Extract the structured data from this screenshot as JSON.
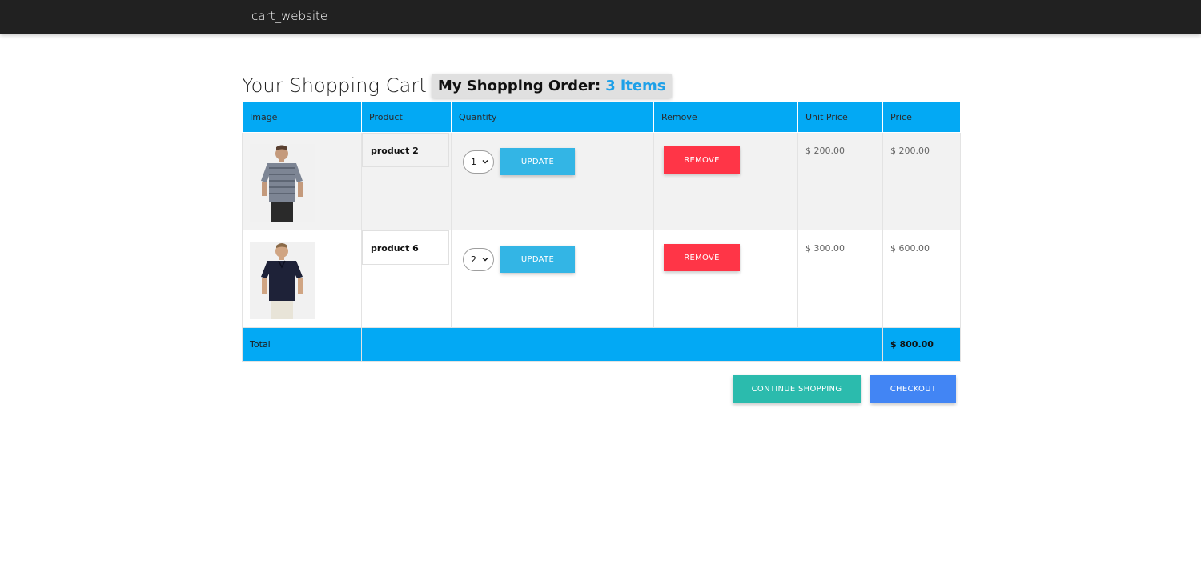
{
  "navbar": {
    "brand": "cart_website"
  },
  "heading": {
    "title": "Your Shopping Cart",
    "order_label": "My Shopping Order:",
    "order_count": "3 items"
  },
  "table": {
    "columns": [
      "Image",
      "Product",
      "Quantity",
      "Remove",
      "Unit Price",
      "Price"
    ],
    "rows": [
      {
        "product": "product 2",
        "quantity": "1",
        "update_label": "UPDATE",
        "remove_label": "REMOVE",
        "unit_price": "$ 200.00",
        "price": "$ 200.00",
        "shirt_color": "#7d8594"
      },
      {
        "product": "product 6",
        "quantity": "2",
        "update_label": "UPDATE",
        "remove_label": "REMOVE",
        "unit_price": "$ 300.00",
        "price": "$ 600.00",
        "shirt_color": "#1e2238"
      }
    ],
    "total_label": "Total",
    "total_value": "$ 800.00"
  },
  "actions": {
    "continue_label": "CONTINUE SHOPPING",
    "checkout_label": "CHECKOUT"
  },
  "colors": {
    "navbar": "#212121",
    "table_header": "#03a9f4",
    "update": "#33b5e5",
    "remove": "#ff3547",
    "continue": "#2bbbad",
    "checkout": "#4285f4"
  }
}
